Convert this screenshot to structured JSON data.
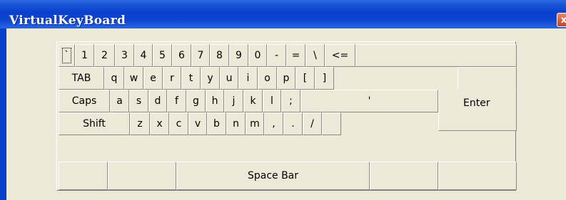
{
  "window": {
    "title": "VirtualKeyBoard",
    "close_label": "x"
  },
  "keyboard": {
    "row1": [
      "`",
      "1",
      "2",
      "3",
      "4",
      "5",
      "6",
      "7",
      "8",
      "9",
      "0",
      "-",
      "=",
      "\\",
      "<=",
      ""
    ],
    "row2": [
      "TAB",
      "q",
      "w",
      "e",
      "r",
      "t",
      "y",
      "u",
      "i",
      "o",
      "p",
      "[",
      "]"
    ],
    "enter": "Enter",
    "row3": [
      "Caps",
      "a",
      "s",
      "d",
      "f",
      "g",
      "h",
      "j",
      "k",
      "l",
      ";",
      "'"
    ],
    "row4": [
      "Shift",
      "z",
      "x",
      "c",
      "v",
      "b",
      "n",
      "m",
      ",",
      ".",
      "/",
      ""
    ],
    "row5": [
      "",
      "",
      "Space Bar",
      "",
      ""
    ]
  }
}
